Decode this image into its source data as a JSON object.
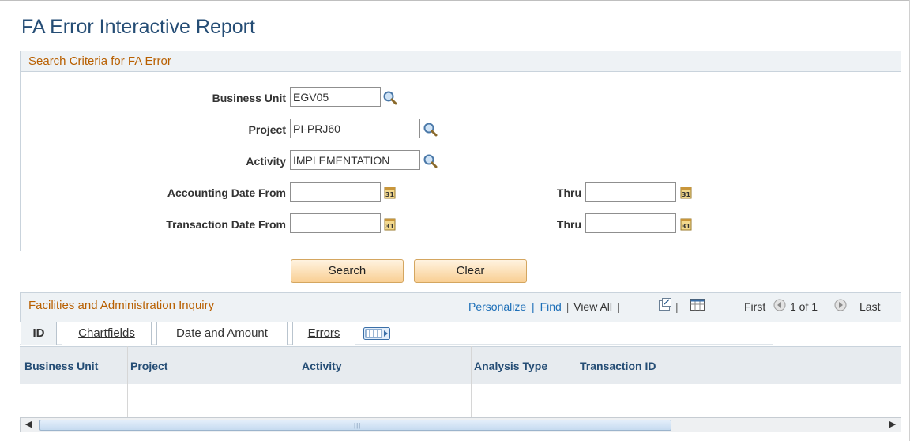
{
  "page": {
    "title": "FA Error Interactive Report"
  },
  "search_panel": {
    "title": "Search Criteria for FA Error",
    "business_unit_label": "Business Unit",
    "business_unit_value": "EGV05",
    "project_label": "Project",
    "project_value": "PI-PRJ60",
    "activity_label": "Activity",
    "activity_value": "IMPLEMENTATION",
    "acct_date_from_label": "Accounting Date From",
    "acct_date_from_value": "",
    "acct_thru_label": "Thru",
    "acct_thru_value": "",
    "txn_date_from_label": "Transaction Date From",
    "txn_date_from_value": "",
    "txn_thru_label": "Thru",
    "txn_thru_value": "",
    "calendar_icon_text": "31"
  },
  "buttons": {
    "search": "Search",
    "clear": "Clear"
  },
  "grid": {
    "title": "Facilities and Administration Inquiry",
    "personalize": "Personalize",
    "sep1": "|",
    "find": "Find",
    "sep2": "|",
    "view_all": "View All",
    "sep3": "|",
    "sep4": "|",
    "first": "First",
    "page_info": "1 of 1",
    "last": "Last",
    "tabs": [
      {
        "label": "ID"
      },
      {
        "label": "Chartfields"
      },
      {
        "label": "Date and Amount"
      },
      {
        "label": "Errors"
      }
    ],
    "columns": [
      "Business Unit",
      "Project",
      "Activity",
      "Analysis Type",
      "Transaction ID"
    ]
  },
  "colors": {
    "title_blue": "#254d75",
    "section_orange": "#b85f00",
    "link_blue": "#1d6fb8",
    "button_gradient_bottom": "#f9cf93"
  },
  "icons": [
    "lookup-icon",
    "calendar-icon",
    "new-window-icon",
    "download-spreadsheet-icon",
    "previous-arrow-icon",
    "next-arrow-icon",
    "show-all-columns-icon",
    "scroll-left-icon",
    "scroll-right-icon"
  ]
}
